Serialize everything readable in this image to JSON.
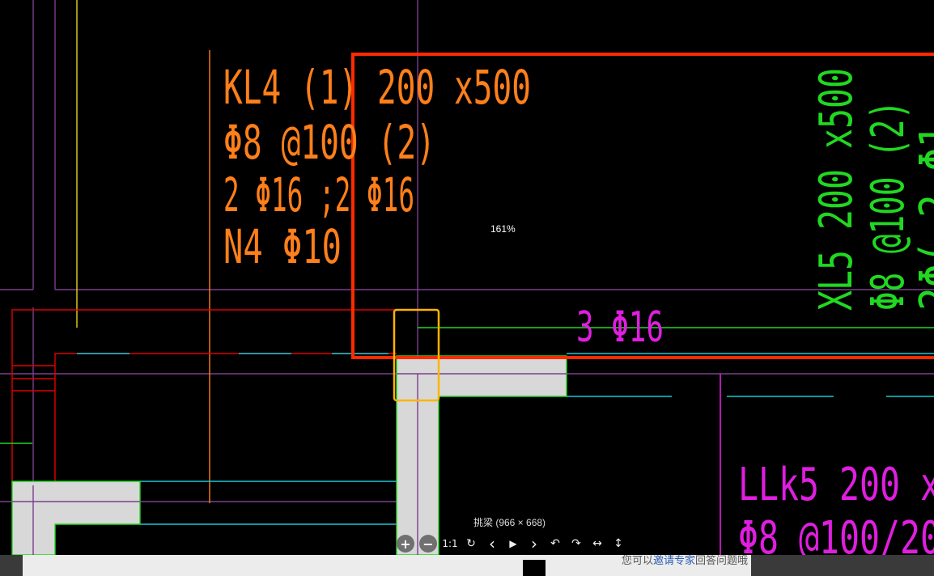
{
  "viewer": {
    "zoom": "161%",
    "caption": "挑梁 (966 × 668)"
  },
  "drawing": {
    "label_kl4": [
      "KL4 (1) 200 x500",
      "Φ8 @100 (2)",
      "2 Φ16 ;2 Φ16",
      "N4 Φ10"
    ],
    "label_xl5": [
      "XL5 200 x500",
      "Φ8 @100 (2)",
      "2Φ( 2 Φ1"
    ],
    "label_3phi16": "3 Φ16",
    "label_llk5": [
      "LLk5 200 x",
      "Φ8 @100/20"
    ],
    "colors": {
      "orange": "#ff7f1a",
      "green": "#21d821",
      "magenta": "#e01ee0",
      "red": "#e00000",
      "highlight_red": "#ff2a00",
      "highlight_yellow": "#ffb400",
      "cyan": "#19c8d6",
      "purple": "#7a3f8f",
      "yellow": "#e6d21a",
      "fill": "#d8d8d8"
    }
  },
  "toolbar": {
    "zoom_in": "+",
    "zoom_out": "−",
    "actual_size": "1:1",
    "rotate": "↻",
    "prev": "‹",
    "play": "▶",
    "next": "›",
    "rotate_left": "↶",
    "rotate_right": "↷",
    "flip_h": "↔",
    "flip_v": "↕"
  },
  "footer": {
    "text_start": "您可以",
    "link": "邀请专家",
    "text_end": "回答问题哦"
  }
}
